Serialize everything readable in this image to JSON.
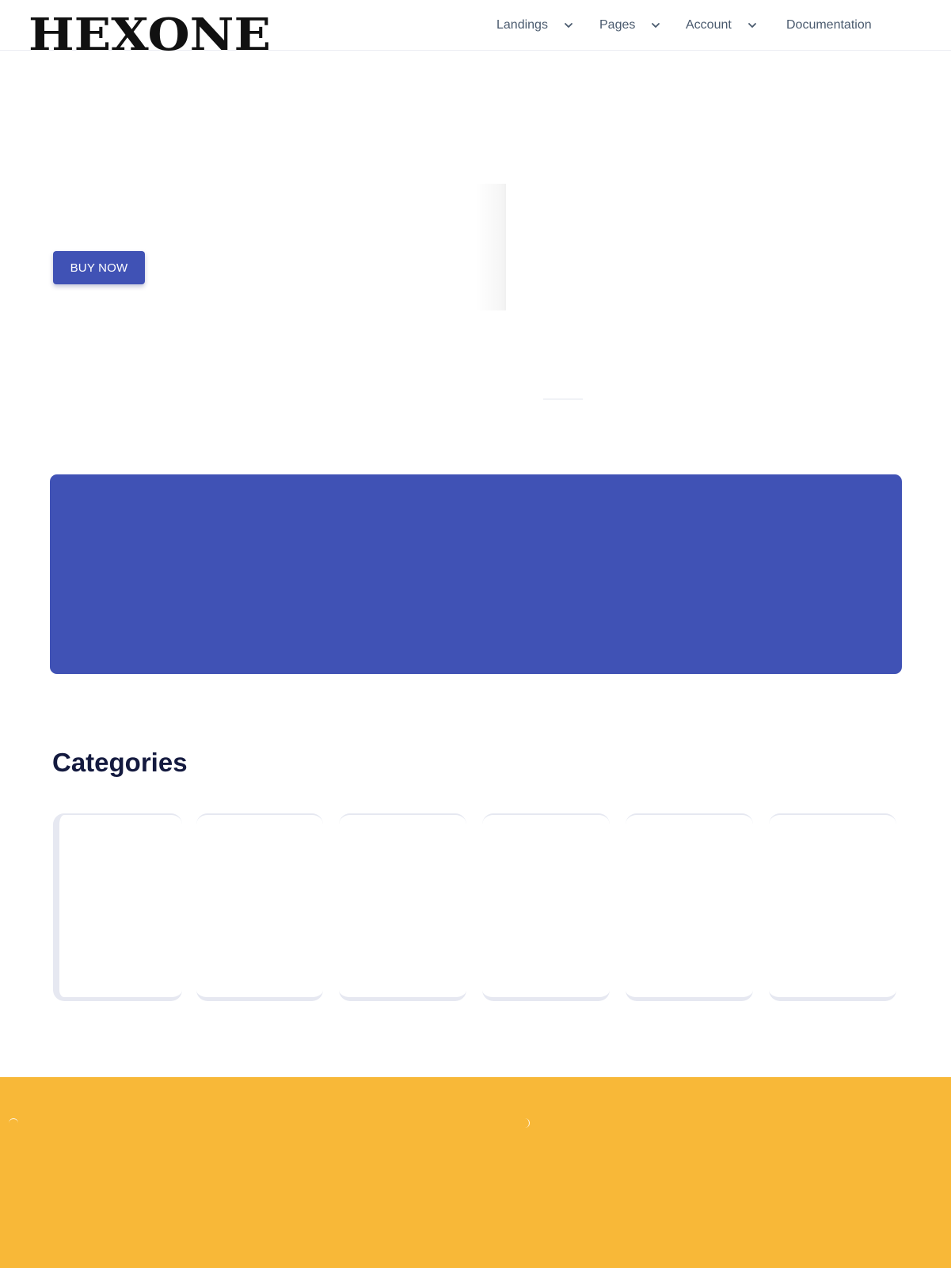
{
  "header": {
    "logo_text": "HEXONE",
    "nav": [
      {
        "label": "Landings",
        "has_dropdown": true,
        "icon": "chevron-down-icon"
      },
      {
        "label": "Pages",
        "has_dropdown": true,
        "icon": "chevron-down-icon"
      },
      {
        "label": "Account",
        "has_dropdown": true,
        "icon": "chevron-down-icon"
      },
      {
        "label": "Documentation",
        "has_dropdown": false
      }
    ]
  },
  "hero": {
    "cta_label": "BUY NOW"
  },
  "categories": {
    "title": "Categories",
    "card_count": 6
  },
  "colors": {
    "brand_blue": "#4052b5",
    "yellow": "#f8b838",
    "heading": "#141a3f",
    "nav_text": "#4a5a6e"
  }
}
